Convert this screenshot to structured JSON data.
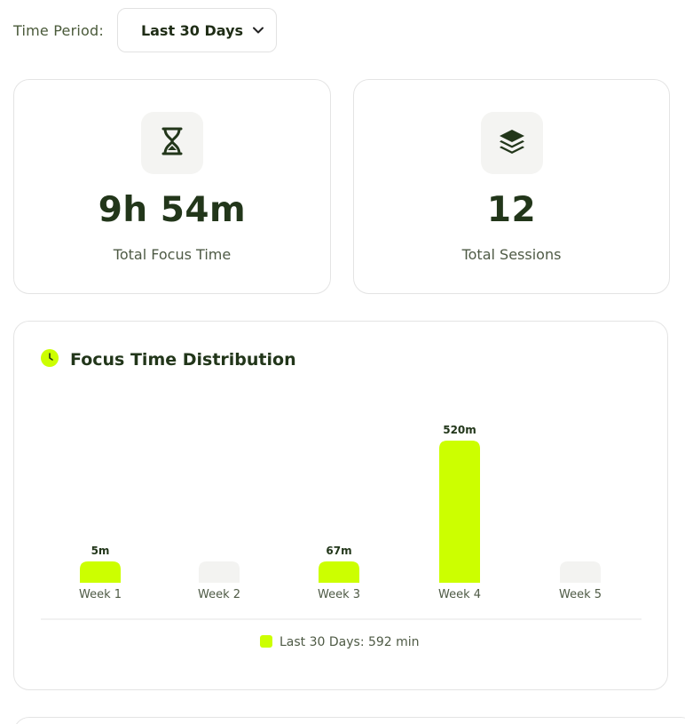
{
  "filter": {
    "label": "Time Period:",
    "selected": "Last 30 Days"
  },
  "stats": {
    "focus_time": {
      "value": "9h 54m",
      "label": "Total Focus Time",
      "icon": "hourglass-icon"
    },
    "sessions": {
      "value": "12",
      "label": "Total Sessions",
      "icon": "layers-icon"
    }
  },
  "chart_section": {
    "title": "Focus Time Distribution",
    "legend": "Last 30 Days: 592 min"
  },
  "colors": {
    "accent": "#ccff00",
    "empty_bar": "#f3f3f1",
    "text_dark": "#22361a"
  },
  "chart_data": {
    "type": "bar",
    "title": "Focus Time Distribution",
    "categories": [
      "Week 1",
      "Week 2",
      "Week 3",
      "Week 4",
      "Week 5"
    ],
    "values": [
      5,
      0,
      67,
      520,
      0
    ],
    "data_labels": [
      "5m",
      "",
      "67m",
      "520m",
      ""
    ],
    "unit": "m",
    "series": [
      {
        "name": "Last 30 Days: 592 min",
        "values": [
          5,
          0,
          67,
          520,
          0
        ]
      }
    ],
    "grid": false,
    "legend_position": "bottom-center"
  }
}
